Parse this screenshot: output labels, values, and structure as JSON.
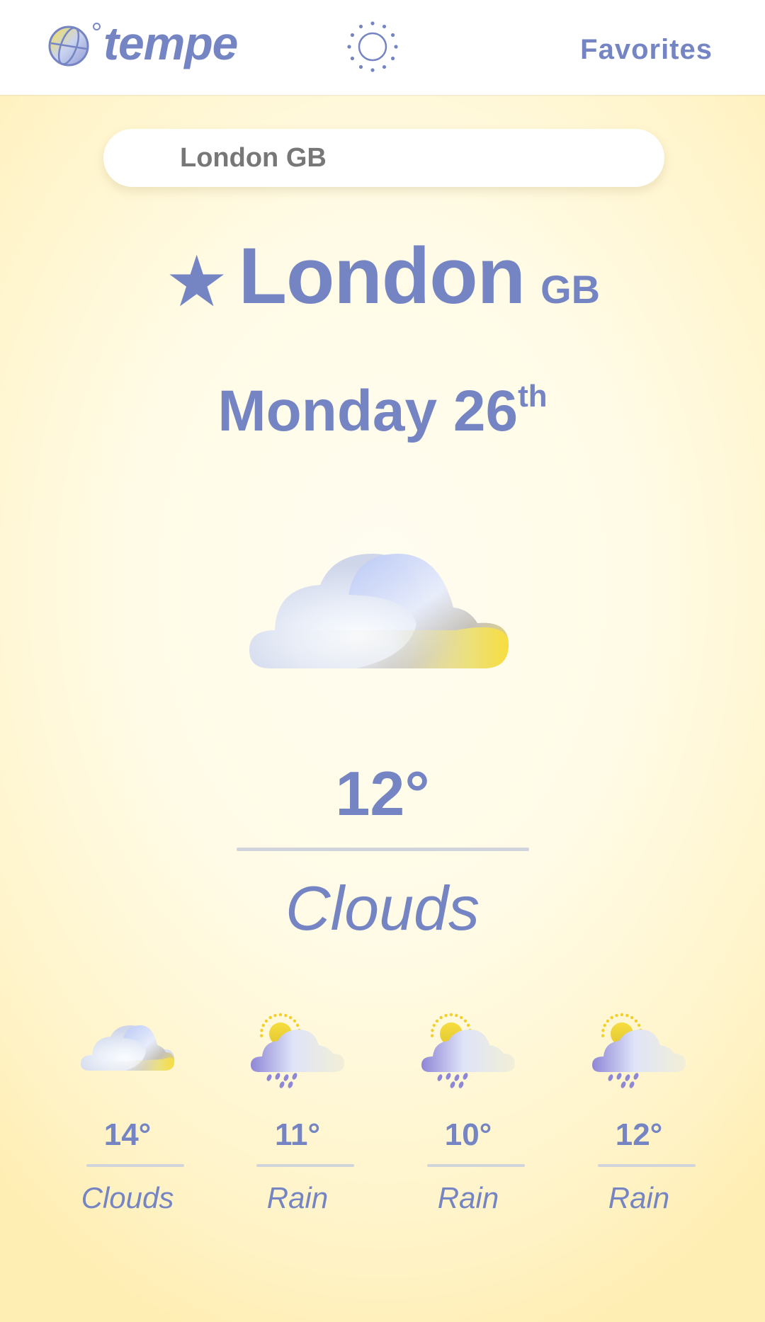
{
  "app": {
    "logo_text": "tempe"
  },
  "header": {
    "favorites_label": "Favorites",
    "theme_toggle_icon": "sun-icon"
  },
  "search": {
    "value": "London GB",
    "placeholder": ""
  },
  "current": {
    "favorite_icon": "star-icon",
    "city": "London",
    "country": "GB",
    "day": "Monday 26",
    "day_suffix": "th",
    "icon": "cloud-icon",
    "temperature": "12°",
    "condition": "Clouds"
  },
  "forecast": [
    {
      "icon": "cloud-icon",
      "temperature": "14°",
      "condition": "Clouds"
    },
    {
      "icon": "sun-cloud-rain-icon",
      "temperature": "11°",
      "condition": "Rain"
    },
    {
      "icon": "sun-cloud-rain-icon",
      "temperature": "10°",
      "condition": "Rain"
    },
    {
      "icon": "sun-cloud-rain-icon",
      "temperature": "12°",
      "condition": "Rain"
    }
  ],
  "colors": {
    "accent": "#7585c4",
    "background": "#fff8d8",
    "divider": "#d2d4db",
    "sun": "#f7dd3f"
  }
}
